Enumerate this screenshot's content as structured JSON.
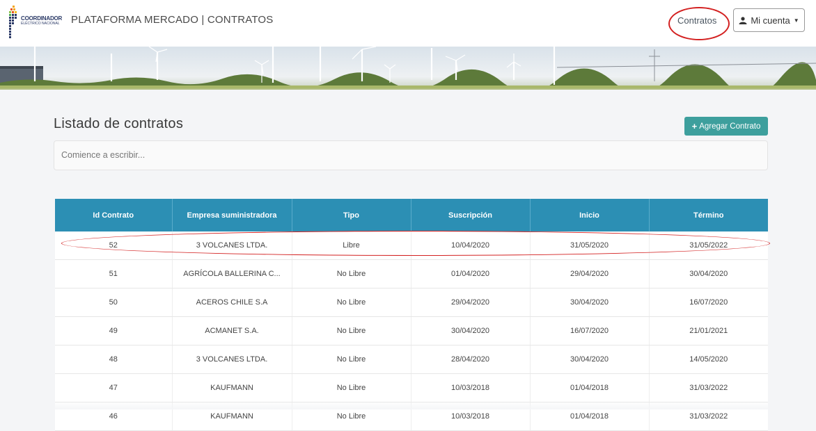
{
  "brand": {
    "logo_name": "COORDINADOR",
    "logo_sub": "ELÉCTRICO NACIONAL",
    "app_title": "PLATAFORMA MERCADO | CONTRATOS"
  },
  "nav": {
    "contracts_link": "Contratos",
    "account_label": "Mi cuenta",
    "account_icon": "user-icon",
    "caret_icon": "caret-down-icon",
    "caret_glyph": "▼"
  },
  "main": {
    "title": "Listado de contratos",
    "add_button": {
      "plus": "+",
      "label": "Agregar Contrato",
      "icon": "plus-icon"
    },
    "search": {
      "placeholder": "Comience a escribir..."
    }
  },
  "table": {
    "columns": [
      "Id Contrato",
      "Empresa suministradora",
      "Tipo",
      "Suscripción",
      "Inicio",
      "Término"
    ],
    "rows": [
      [
        "52",
        "3 VOLCANES LTDA.",
        "Libre",
        "10/04/2020",
        "31/05/2020",
        "31/05/2022"
      ],
      [
        "51",
        "AGRÍCOLA BALLERINA C...",
        "No Libre",
        "01/04/2020",
        "29/04/2020",
        "30/04/2020"
      ],
      [
        "50",
        "ACEROS CHILE S.A",
        "No Libre",
        "29/04/2020",
        "30/04/2020",
        "16/07/2020"
      ],
      [
        "49",
        "ACMANET S.A.",
        "No Libre",
        "30/04/2020",
        "16/07/2020",
        "21/01/2021"
      ],
      [
        "48",
        "3 VOLCANES LTDA.",
        "No Libre",
        "28/04/2020",
        "30/04/2020",
        "14/05/2020"
      ],
      [
        "47",
        "KAUFMANN",
        "No Libre",
        "10/03/2018",
        "01/04/2018",
        "31/03/2022"
      ],
      [
        "46",
        "KAUFMANN",
        "No Libre",
        "10/03/2018",
        "01/04/2018",
        "31/03/2022"
      ]
    ]
  },
  "colors": {
    "header_bg": "#2c8fb4",
    "add_button_bg": "#3d9f9d",
    "annotation": "#d32020"
  }
}
